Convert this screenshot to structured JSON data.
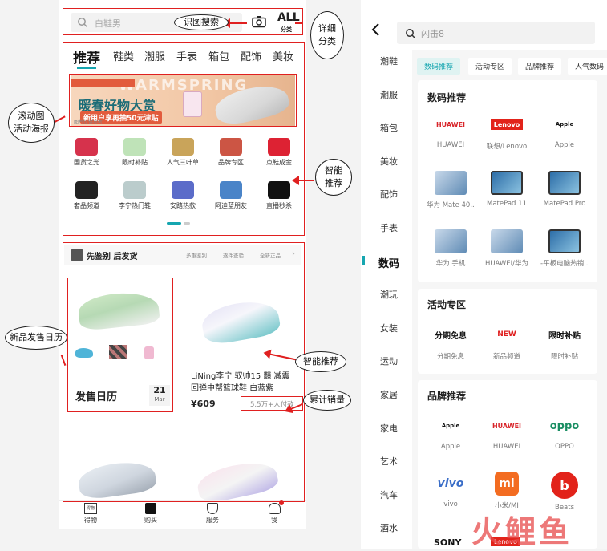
{
  "left": {
    "search_placeholder": "白鞋男",
    "scan_search": "识图搜索",
    "all_label": "ALL",
    "all_sub": "分类",
    "tabs": [
      "推荐",
      "鞋类",
      "潮服",
      "手表",
      "箱包",
      "配饰",
      "美妆"
    ],
    "banner": {
      "bg_text": "WARMSPRING",
      "title": "暖春好物大赏",
      "sub": "新用户享再抽50元津贴",
      "tag": "图片仅供参考"
    },
    "icons_row1": [
      "国货之光",
      "限时补贴",
      "人气三叶草",
      "品牌专区",
      "点鞋成金"
    ],
    "icons_row2": [
      "奢品频道",
      "李宁热门鞋",
      "安踏热款",
      "阿迪蓝朋友",
      "直播秒杀"
    ],
    "verify_bar": {
      "title": "先鉴别 后发货",
      "items": [
        "多重鉴别",
        "逐件查验",
        "全新正品"
      ]
    },
    "calendar": {
      "title": "发售日历",
      "day": "21",
      "month": "Mar"
    },
    "product": {
      "title": "LiNing李宁 驭帅15 䨻 减震回弹中帮篮球鞋 白蓝紫",
      "price": "¥609",
      "sales": "5.5万+人付款"
    },
    "bottom_nav": [
      "得物",
      "购买",
      "服务",
      "我"
    ],
    "annotations": {
      "detail": [
        "详细",
        "分类"
      ],
      "scroll": [
        "滚动图",
        "活动海报"
      ],
      "smart": [
        "智能",
        "推荐"
      ],
      "calendar": "新品发售日历",
      "smart2": "智能推荐",
      "sales": "累计销量"
    }
  },
  "right": {
    "search_placeholder": "闪击8",
    "sidebar": [
      "潮鞋",
      "潮服",
      "箱包",
      "美妆",
      "配饰",
      "手表",
      "数码",
      "潮玩",
      "女装",
      "运动",
      "家居",
      "家电",
      "艺术",
      "汽车",
      "酒水"
    ],
    "active_index": 6,
    "top_tabs": [
      "数码推荐",
      "活动专区",
      "品牌推荐",
      "人气数码"
    ],
    "section1": {
      "title": "数码推荐",
      "items": [
        "HUAWEI",
        "联想/Lenovo",
        "Apple",
        "华为 Mate 40...",
        "MatePad 11",
        "MatePad Pro",
        "华为 手机",
        "HUAWEI/华为",
        "-平板电脑热销..."
      ]
    },
    "section2": {
      "title": "活动专区",
      "items": [
        "分期免息",
        "新品频道",
        "限时补贴"
      ],
      "logos": [
        "分期免息",
        "NEW",
        "限时补贴"
      ]
    },
    "section3": {
      "title": "品牌推荐",
      "items": [
        "Apple",
        "HUAWEI",
        "OPPO",
        "vivo",
        "小米/MI",
        "Beats"
      ],
      "logos": [
        "Apple",
        "HUAWEI",
        "oppo",
        "vivo",
        "mi",
        "b"
      ],
      "more": [
        "SONY",
        "Lenovo"
      ]
    },
    "watermark": "火鲤鱼"
  },
  "colors": {
    "accent": "#e02020",
    "teal": "#16a6b0",
    "banner_bg": "#f2c7a5"
  }
}
